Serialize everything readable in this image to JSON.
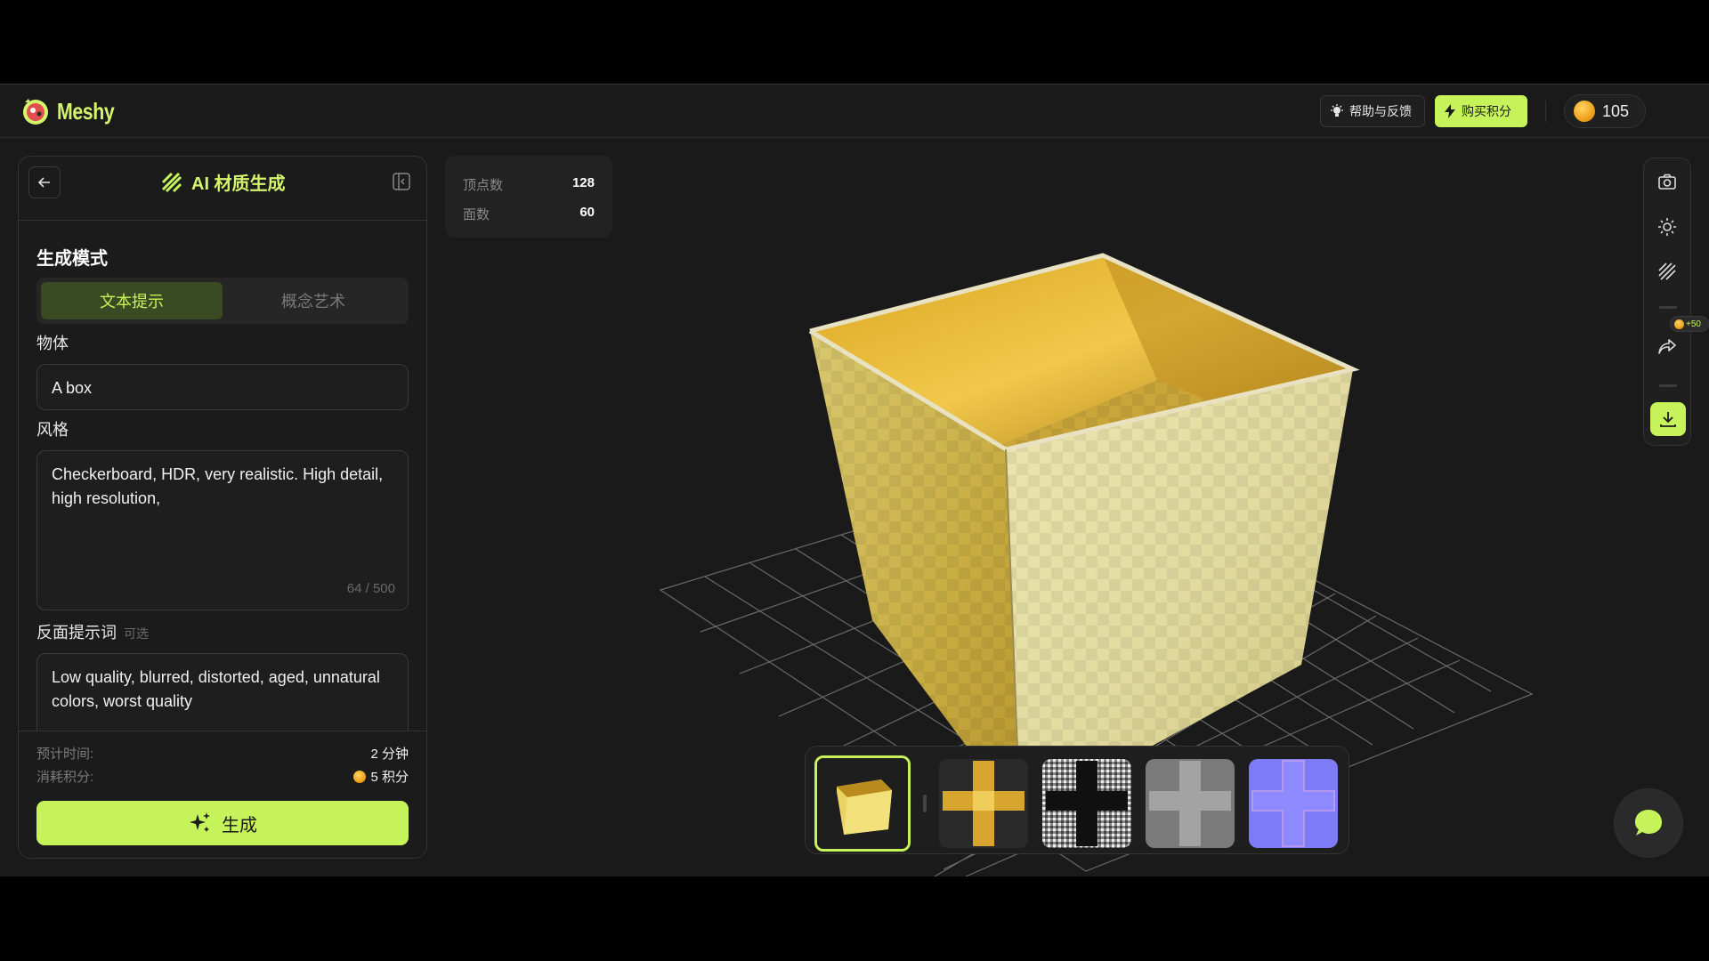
{
  "header": {
    "logo_text": "Meshy",
    "help_label": "帮助与反馈",
    "buy_label": "购买积分",
    "credits": "105"
  },
  "panel": {
    "title": "AI 材质生成",
    "mode_title": "生成模式",
    "tabs": [
      {
        "label": "文本提示",
        "active": true
      },
      {
        "label": "概念艺术",
        "active": false
      }
    ],
    "object_label": "物体",
    "object_value": "A box",
    "style_label": "风格",
    "style_value": "Checkerboard, HDR, very realistic. High detail, high resolution,",
    "style_counter": "64 / 500",
    "negative_label": "反面提示词",
    "negative_optional": "可选",
    "negative_value": "Low quality, blurred, distorted, aged, unnatural colors, worst quality",
    "est_time_label": "预计时间:",
    "est_time_value": "2 分钟",
    "cost_label": "消耗积分:",
    "cost_value": "5 积分",
    "generate_label": "生成"
  },
  "stats": {
    "vertices_label": "顶点数",
    "vertices_value": "128",
    "faces_label": "面数",
    "faces_value": "60"
  },
  "toolbar": {
    "share_bonus": "+50",
    "icons": [
      "camera-icon",
      "light-icon",
      "texture-icon",
      "share-icon",
      "download-icon"
    ]
  },
  "thumbnails": [
    "preview",
    "base-color-map",
    "metallic-map",
    "roughness-map",
    "normal-map"
  ],
  "colors": {
    "accent": "#c6f35a",
    "background": "#1a1a1a"
  }
}
